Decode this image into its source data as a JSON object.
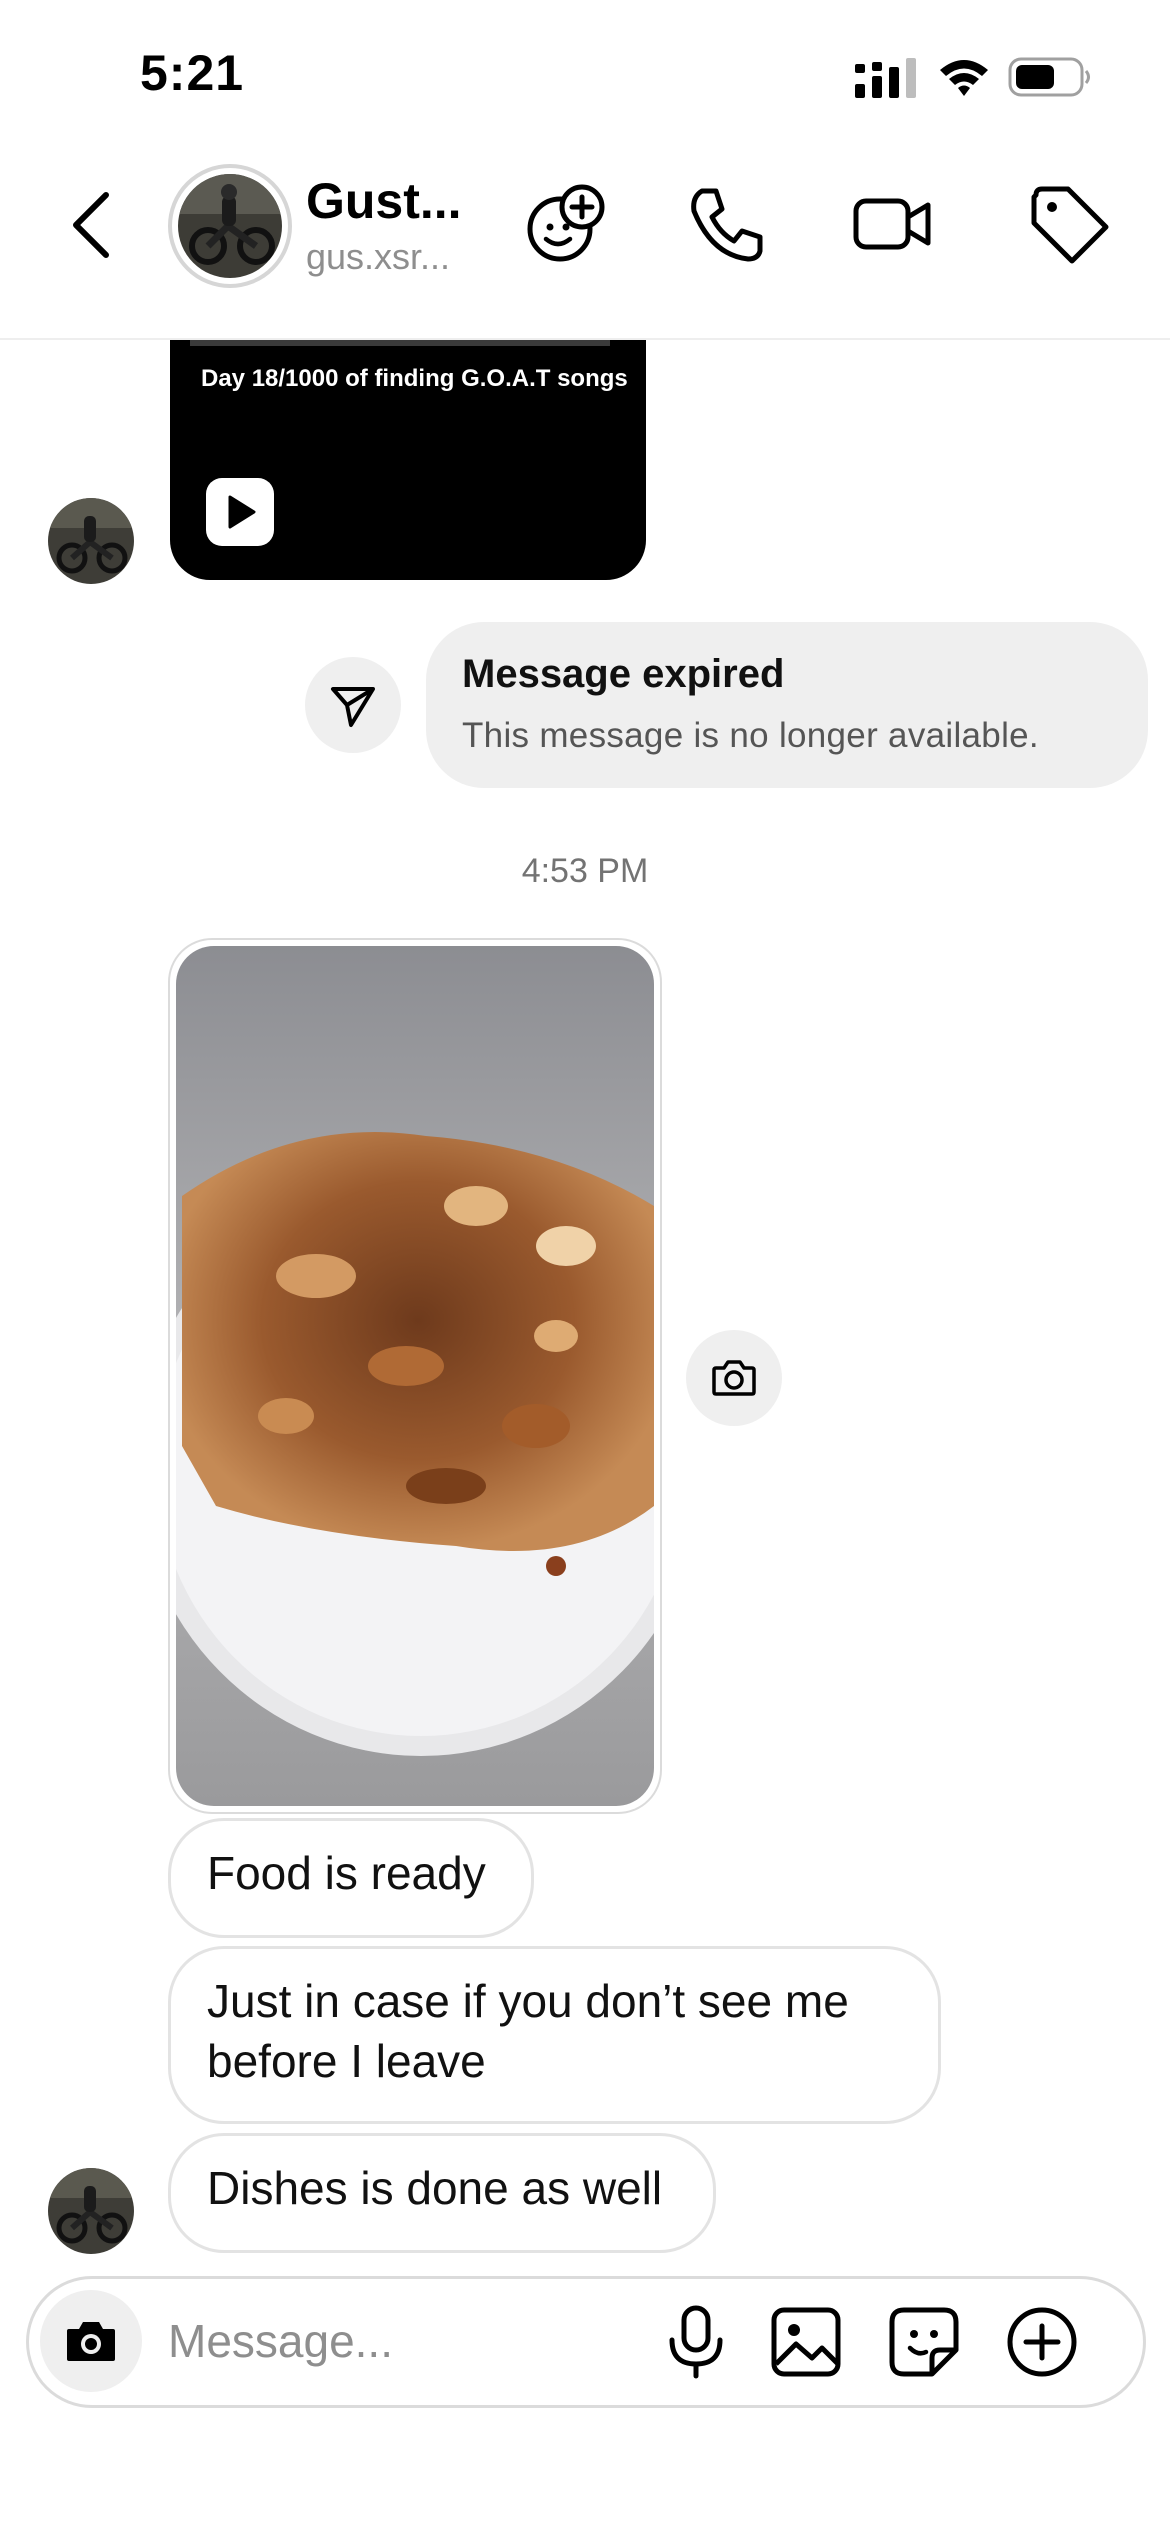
{
  "status_bar": {
    "time": "5:21"
  },
  "header": {
    "name": "Gust...",
    "username": "gus.xsr...",
    "icons": [
      "back-chevron-icon",
      "add-effects-icon",
      "phone-icon",
      "video-camera-icon",
      "tag-icon"
    ]
  },
  "reel": {
    "caption": "Day 18/1000 of finding G.O.A.T songs",
    "icon": "play-icon"
  },
  "expired": {
    "title": "Message expired",
    "subtitle": "This message is no longer available.",
    "icon": "send-icon"
  },
  "timestamp": "4:53 PM",
  "messages": [
    {
      "text": "Food is ready"
    },
    {
      "text": "Just in case if you don’t see me before I leave"
    },
    {
      "text": "Dishes is done as well"
    }
  ],
  "composer": {
    "placeholder": "Message...",
    "icons": [
      "camera-icon",
      "microphone-icon",
      "gallery-icon",
      "sticker-icon",
      "plus-icon"
    ]
  },
  "colors": {
    "bubble_border": "#e3e3e3",
    "expired_bg": "#efefef",
    "muted_text": "#8e8e8e"
  }
}
